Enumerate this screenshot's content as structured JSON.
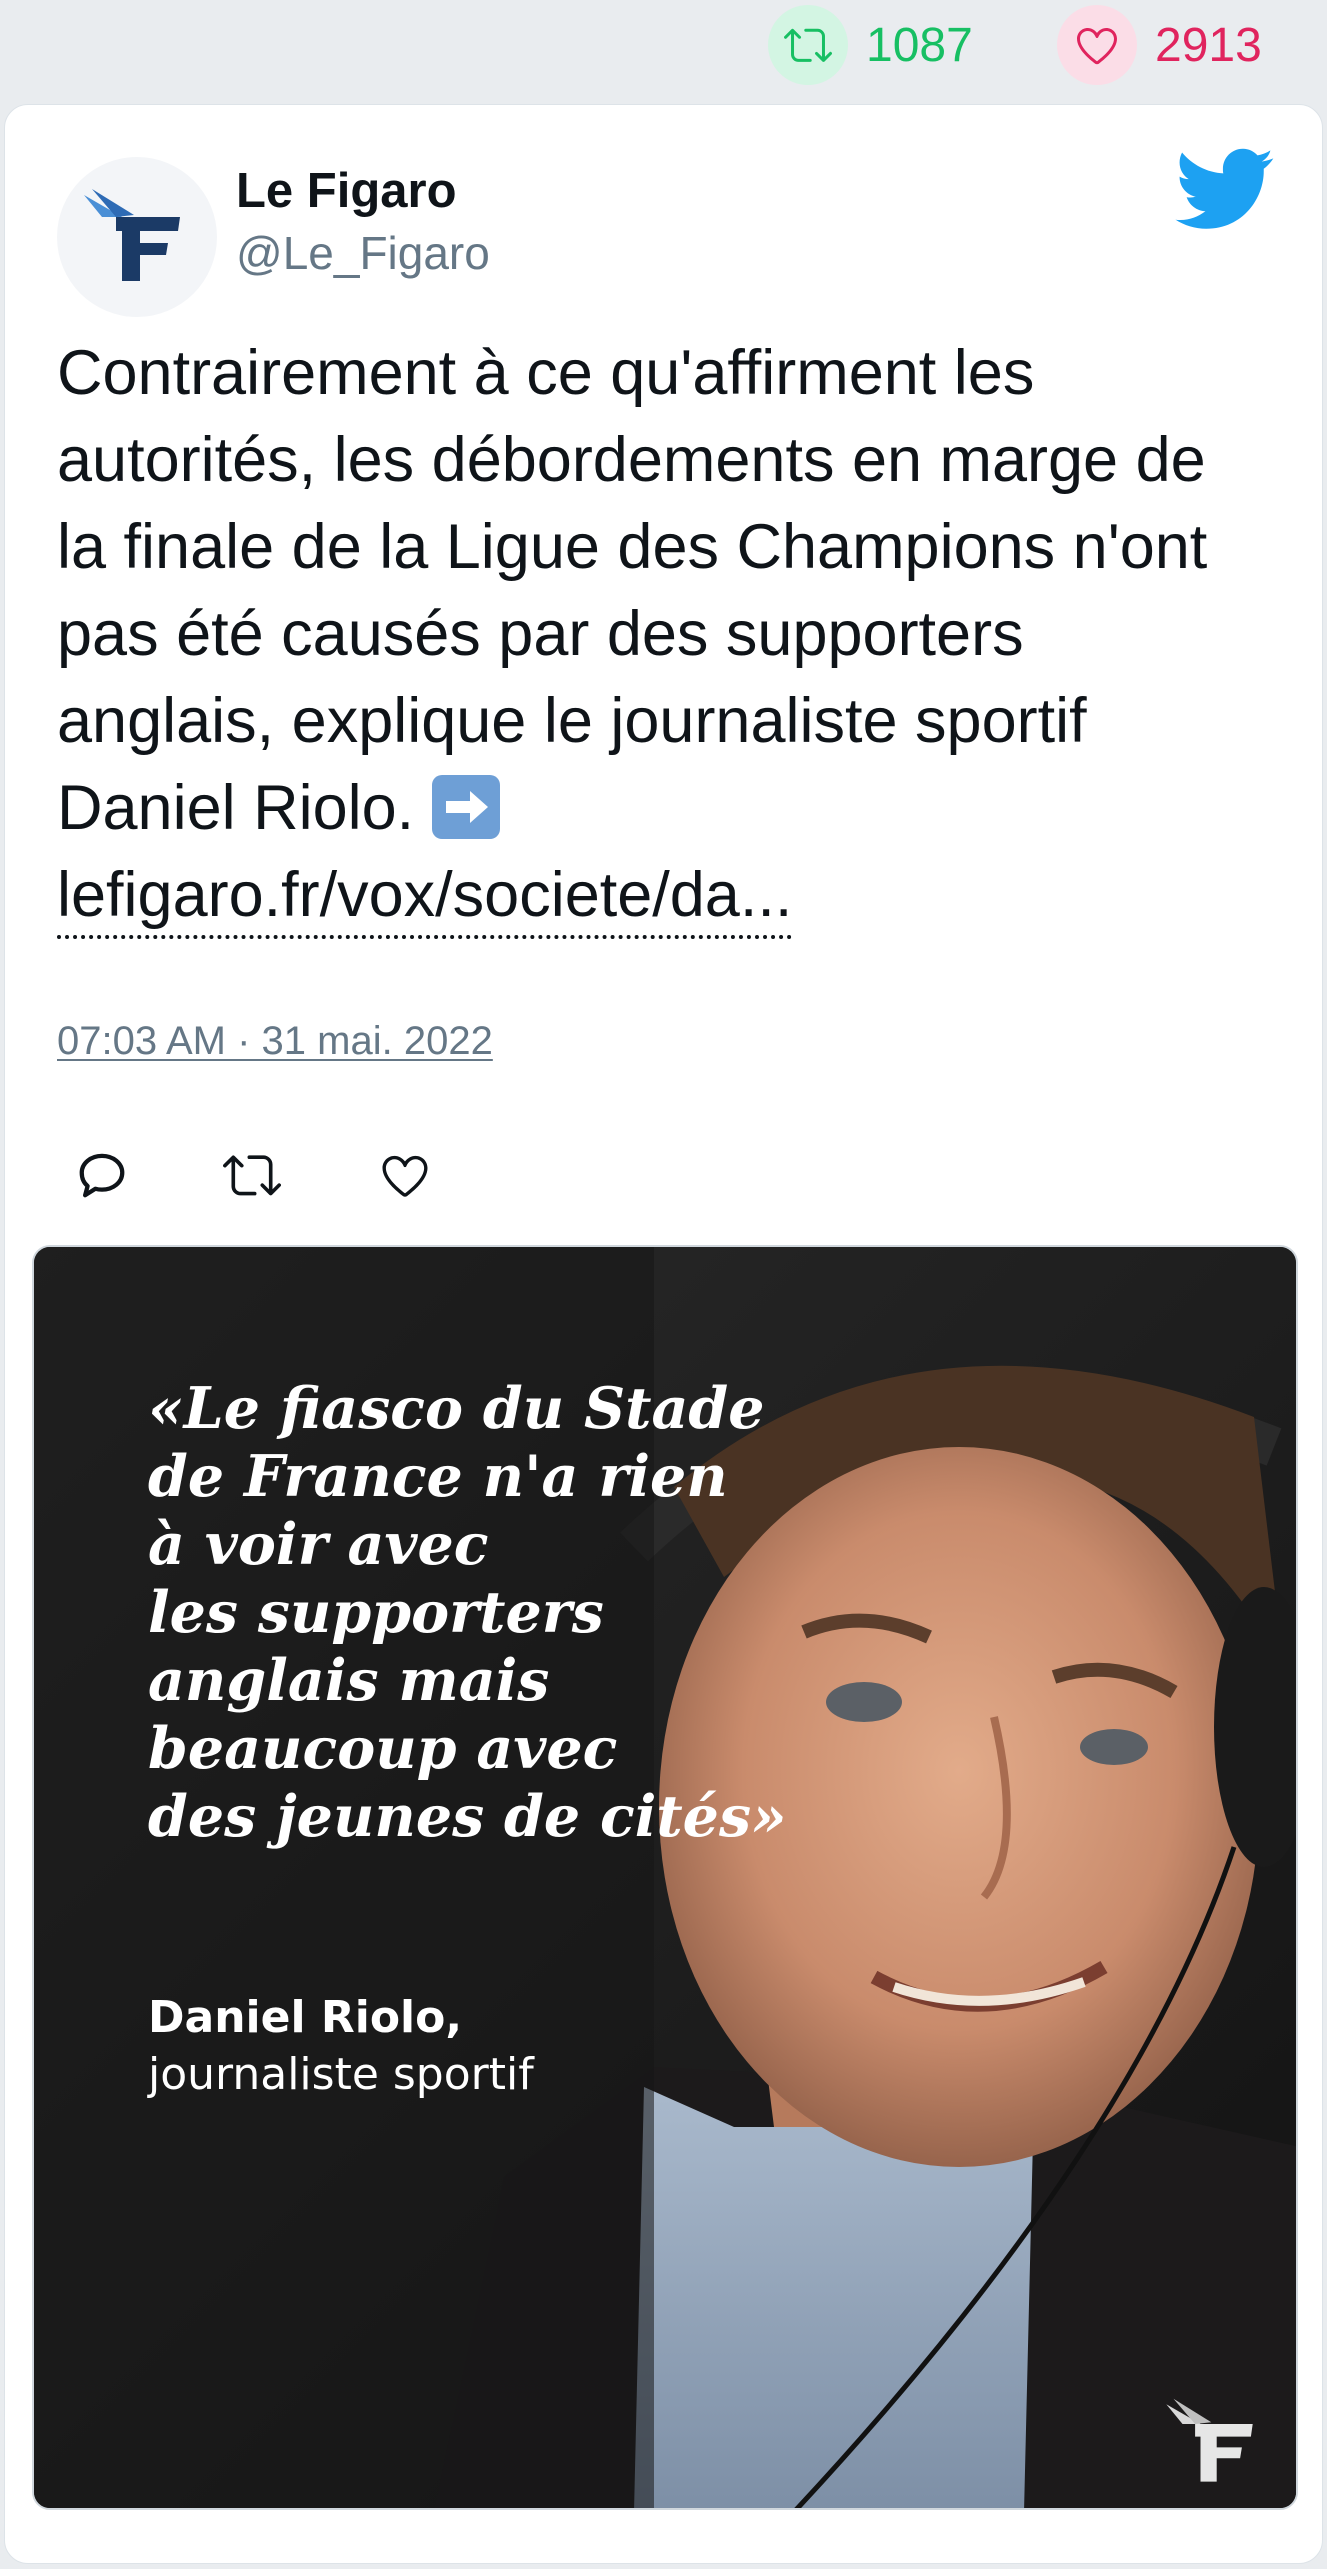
{
  "stats": {
    "retweets": "1087",
    "likes": "2913"
  },
  "tweet": {
    "author_name": "Le Figaro",
    "author_handle": "@Le_Figaro",
    "text_lines": [
      "Contrairement à ce qu'affirment les",
      "autorités, les débordements en marge de",
      "la finale de la Ligue des Champions n'ont",
      "pas été causés par des supporters",
      "anglais, explique le journaliste sportif",
      "Daniel Riolo."
    ],
    "link_text": "lefigaro.fr/vox/societe/da...",
    "timestamp": "07:03 AM · 31 mai. 2022"
  },
  "media": {
    "quote_lines": [
      "«Le fiasco du Stade",
      "de France n'a rien",
      "à voir avec",
      "les supporters",
      "anglais mais",
      "beaucoup avec",
      "des jeunes de cités»"
    ],
    "speaker_name": "Daniel Riolo,",
    "speaker_role": "journaliste sportif"
  },
  "icons": {
    "retweet": "retweet-icon",
    "like": "heart-icon",
    "reply": "reply-icon",
    "twitter": "twitter-bird-icon",
    "arrow": "right-arrow-emoji-icon"
  },
  "colors": {
    "retweet_green": "#17bf63",
    "like_red": "#e0245e",
    "twitter_blue": "#1da1f2",
    "muted_text": "#657786"
  }
}
